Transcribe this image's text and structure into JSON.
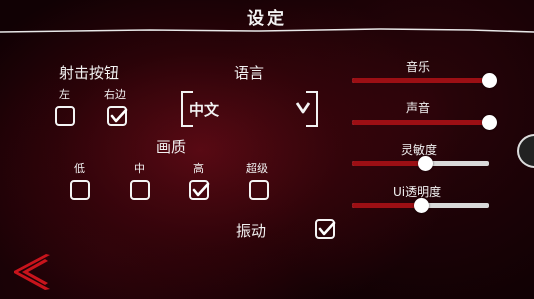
{
  "title": "设定",
  "fire_button": {
    "label": "射击按钮",
    "options": [
      {
        "label": "左",
        "checked": false
      },
      {
        "label": "右边",
        "checked": true
      }
    ]
  },
  "language": {
    "label": "语言",
    "selected": "中文"
  },
  "quality": {
    "label": "画质",
    "options": [
      {
        "label": "低",
        "checked": false
      },
      {
        "label": "中",
        "checked": false
      },
      {
        "label": "高",
        "checked": true
      },
      {
        "label": "超级",
        "checked": false
      }
    ]
  },
  "vibration": {
    "label": "振动",
    "checked": true
  },
  "sliders": [
    {
      "label": "音乐",
      "value": 1.0
    },
    {
      "label": "声音",
      "value": 1.0
    },
    {
      "label": "灵敏度",
      "value": 0.53
    },
    {
      "label": "Ui透明度",
      "value": 0.5
    }
  ],
  "colors": {
    "accent": "#9c0f14",
    "background": "#2a0308",
    "text": "#f2f2f2",
    "back_arrow": "#c8141c"
  },
  "icons": {
    "back": "back-arrow-icon",
    "dropdown": "chevron-down-icon",
    "check": "checkmark-icon"
  }
}
